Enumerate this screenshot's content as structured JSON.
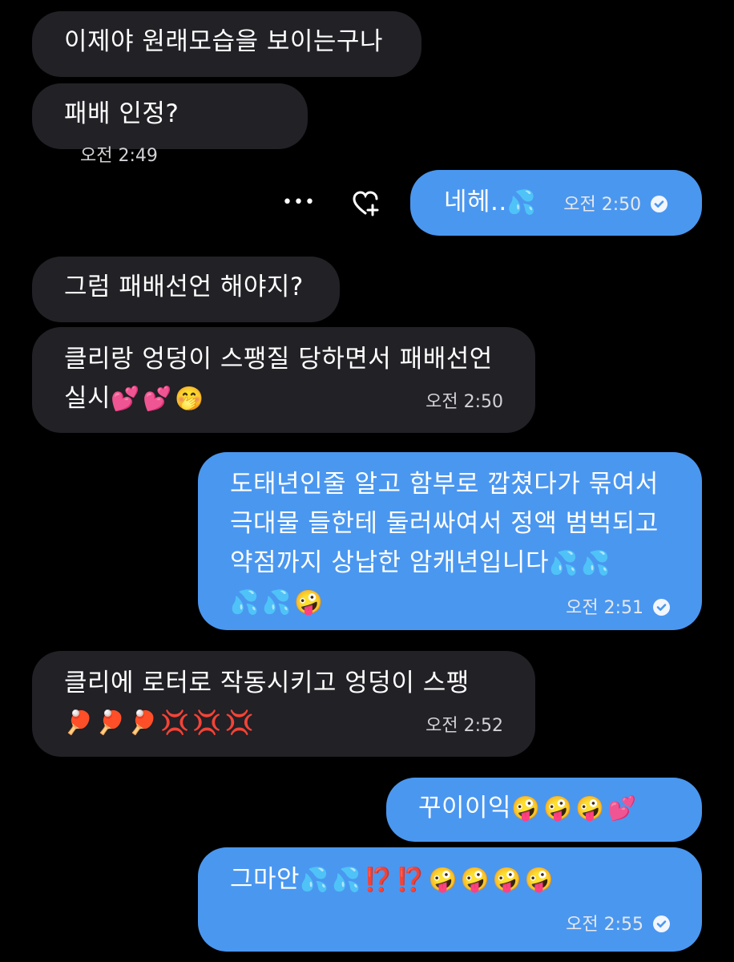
{
  "messages": [
    {
      "text": "이제야 원래모습을 보이는구나",
      "emoji": "",
      "time": ""
    },
    {
      "text": "패배 인정?",
      "emoji": "",
      "time": "오전 2:49"
    },
    {
      "text": "네헤..",
      "emoji": "💦",
      "time": "오전 2:50"
    },
    {
      "text": "그럼 패배선언 해야지?",
      "emoji": "",
      "time": ""
    },
    {
      "text": "클리랑 엉덩이 스팽질 당하면서 패배선언",
      "text2": "실시",
      "emoji": "💕💕🤭",
      "time": "오전 2:50"
    },
    {
      "line1": "도태년인줄 알고 함부로 깝쳤다가 묶여서",
      "line2": "극대물 들한테 둘러싸여서 정액 범벅되고",
      "line3": "약점까지 상납한 암캐년입니다",
      "emoji3": "💦💦",
      "emoji4": "💦💦🤪",
      "time": "오전 2:51"
    },
    {
      "text": "클리에 로터로 작동시키고 엉덩이 스팽",
      "emoji": "🏓🏓🏓💢💢💢",
      "time": "오전 2:52"
    },
    {
      "text": "꾸이이익",
      "emoji": "🤪🤪🤪💕",
      "time": ""
    },
    {
      "text": "그마안",
      "emoji": "💦💦⁉️⁉️🤪🤪🤪🤪",
      "time": "오전 2:55"
    }
  ],
  "actions": {
    "more": "•••",
    "react_icon": "heart-plus-icon"
  },
  "colors": {
    "incoming": "#212126",
    "outgoing": "#4a97f0",
    "background": "#000000"
  }
}
